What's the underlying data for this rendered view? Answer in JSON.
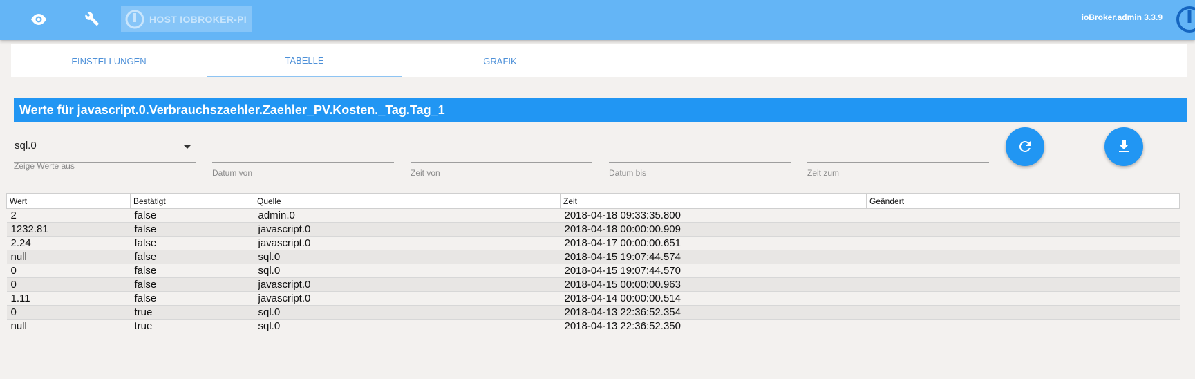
{
  "header": {
    "host_label": "HOST IOBROKER-PI",
    "version": "ioBroker.admin 3.3.9",
    "icons": [
      "eye-icon",
      "wrench-icon",
      "iobroker-logo-icon"
    ]
  },
  "tabs": [
    {
      "label": "EINSTELLUNGEN",
      "active": false
    },
    {
      "label": "TABELLE",
      "active": true
    },
    {
      "label": "GRAFIK",
      "active": false
    }
  ],
  "title": "Werte für javascript.0.Verbrauchszaehler.Zaehler_PV.Kosten._Tag.Tag_1",
  "filters": {
    "instance_value": "sql.0",
    "instance_label": "Zeige Werte aus",
    "date_from_label": "Datum von",
    "time_from_label": "Zeit von",
    "date_to_label": "Datum bis",
    "time_to_label": "Zeit zum"
  },
  "actions": [
    "refresh-icon",
    "download-icon"
  ],
  "table": {
    "columns": [
      "Wert",
      "Bestätigt",
      "Quelle",
      "Zeit",
      "Geändert"
    ],
    "rows": [
      [
        "2",
        "false",
        "admin.0",
        "2018-04-18 09:33:35.800",
        ""
      ],
      [
        "1232.81",
        "false",
        "javascript.0",
        "2018-04-18 00:00:00.909",
        ""
      ],
      [
        "2.24",
        "false",
        "javascript.0",
        "2018-04-17 00:00:00.651",
        ""
      ],
      [
        "null",
        "false",
        "sql.0",
        "2018-04-15 19:07:44.574",
        ""
      ],
      [
        "0",
        "false",
        "sql.0",
        "2018-04-15 19:07:44.570",
        ""
      ],
      [
        "0",
        "false",
        "javascript.0",
        "2018-04-15 00:00:00.963",
        ""
      ],
      [
        "1.11",
        "false",
        "javascript.0",
        "2018-04-14 00:00:00.514",
        ""
      ],
      [
        "0",
        "true",
        "sql.0",
        "2018-04-13 22:36:52.354",
        ""
      ],
      [
        "null",
        "true",
        "sql.0",
        "2018-04-13 22:36:52.350",
        ""
      ]
    ]
  },
  "colors": {
    "topbar": "#64b5f6",
    "accent": "#2196f3",
    "tab_text": "#4d90d8"
  }
}
